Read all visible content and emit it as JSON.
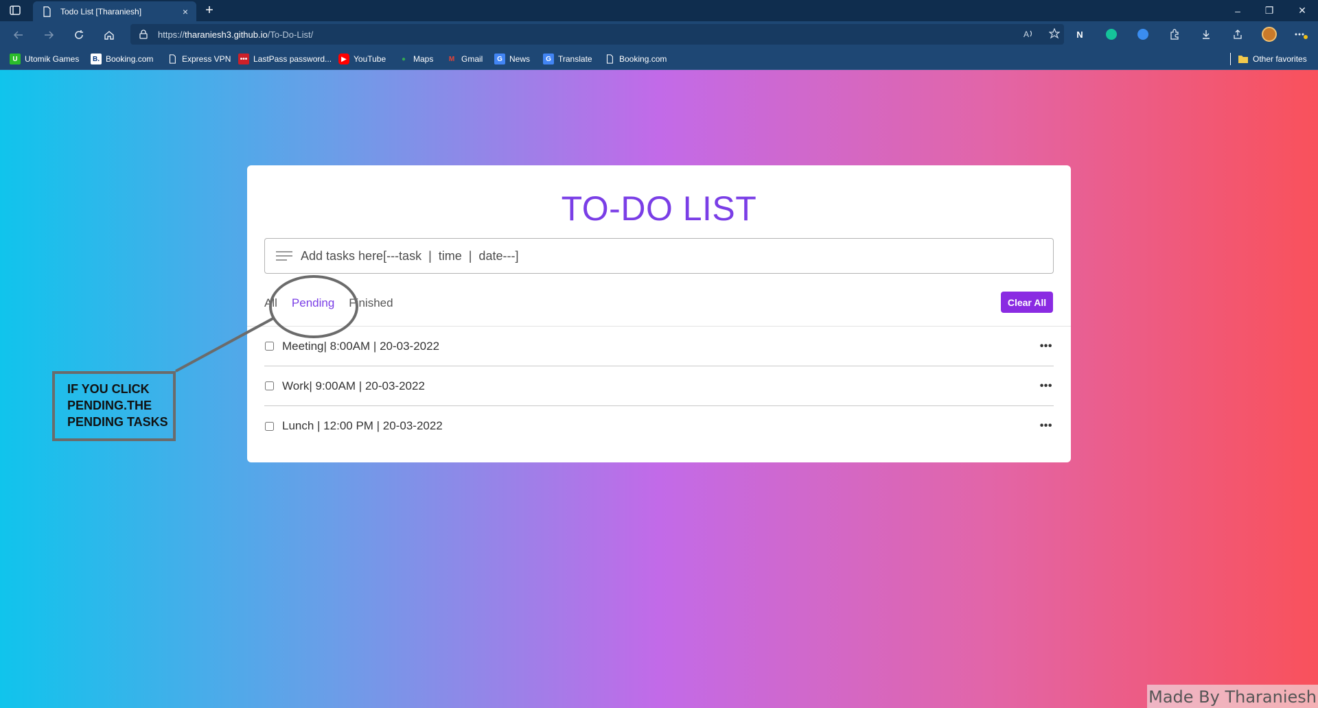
{
  "browser": {
    "tab_title": "Todo List [Tharaniesh]",
    "tab_close": "×",
    "new_tab": "+",
    "window_controls": [
      "–",
      "❐",
      "✕"
    ],
    "url_prefix": "https://",
    "url_host": "tharaniesh3.github.io",
    "url_path": "/To-Do-List/",
    "extension_letter": "N",
    "bookmarks": [
      {
        "label": "Utomik Games",
        "icon": "utomik-icon"
      },
      {
        "label": "Booking.com",
        "icon": "booking-icon"
      },
      {
        "label": "Express VPN",
        "icon": "page-icon"
      },
      {
        "label": "LastPass password...",
        "icon": "lastpass-icon"
      },
      {
        "label": "YouTube",
        "icon": "youtube-icon"
      },
      {
        "label": "Maps",
        "icon": "maps-icon"
      },
      {
        "label": "Gmail",
        "icon": "gmail-icon"
      },
      {
        "label": "News",
        "icon": "news-icon"
      },
      {
        "label": "Translate",
        "icon": "translate-icon"
      },
      {
        "label": "Booking.com",
        "icon": "page-icon"
      }
    ],
    "other_favorites": "Other favorites"
  },
  "app": {
    "title": "TO-DO LIST",
    "input_placeholder": "Add tasks here[---task  |  time  |  date---]",
    "filters": [
      "All",
      "Pending",
      "Finished"
    ],
    "active_filter": "Pending",
    "clear_all_label": "Clear All",
    "tasks": [
      {
        "text": "Meeting| 8:00AM | 20-03-2022",
        "done": false
      },
      {
        "text": "Work| 9:00AM | 20-03-2022",
        "done": false
      },
      {
        "text": "Lunch | 12:00 PM | 20-03-2022",
        "done": false
      }
    ],
    "task_menu": "•••"
  },
  "annotation": {
    "lines": [
      "IF YOU CLICK",
      "PENDING.THE",
      "PENDING TASKS"
    ]
  },
  "credit": "Made By Tharaniesh",
  "colors": {
    "accent": "#7a3ee6",
    "button": "#8a2be2",
    "gradient": [
      "#10c4ec",
      "#c26ae8",
      "#f9515b"
    ]
  }
}
